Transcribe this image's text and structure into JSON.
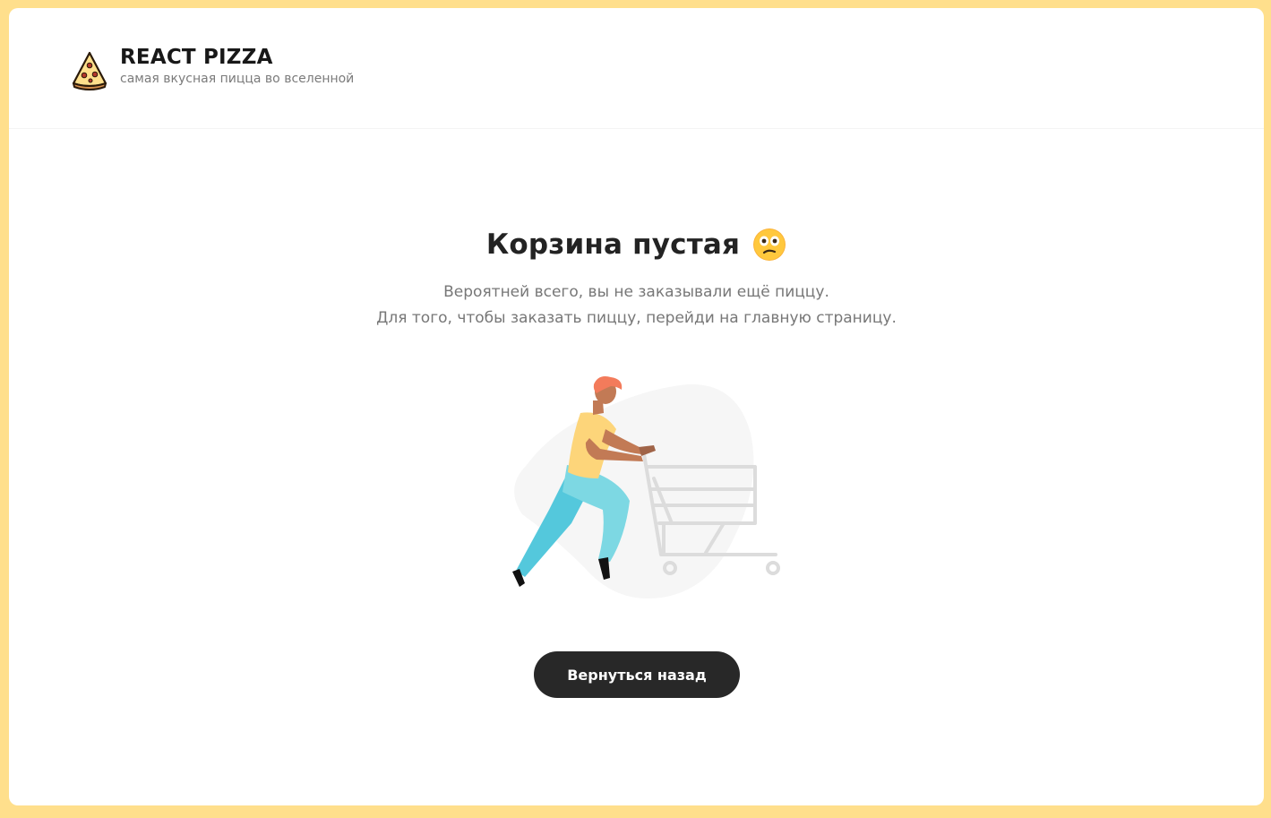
{
  "header": {
    "logo_title": "REACT PIZZA",
    "logo_subtitle": "самая вкусная пицца во вселенной",
    "logo_icon": "pizza-slice-icon"
  },
  "cart_empty": {
    "title": "Корзина пустая",
    "emoji": "confused-face-emoji",
    "text_line_1": "Вероятней всего, вы не заказывали ещё пиццу.",
    "text_line_2": "Для того, чтобы заказать пиццу, перейди на главную страницу.",
    "illustration": "person-pushing-empty-shopping-cart",
    "back_button_label": "Вернуться назад"
  },
  "colors": {
    "page_background": "#ffdf8c",
    "card_background": "#ffffff",
    "button_background": "#282828",
    "button_text": "#ffffff",
    "title_text": "#232323",
    "muted_text": "#777777"
  }
}
